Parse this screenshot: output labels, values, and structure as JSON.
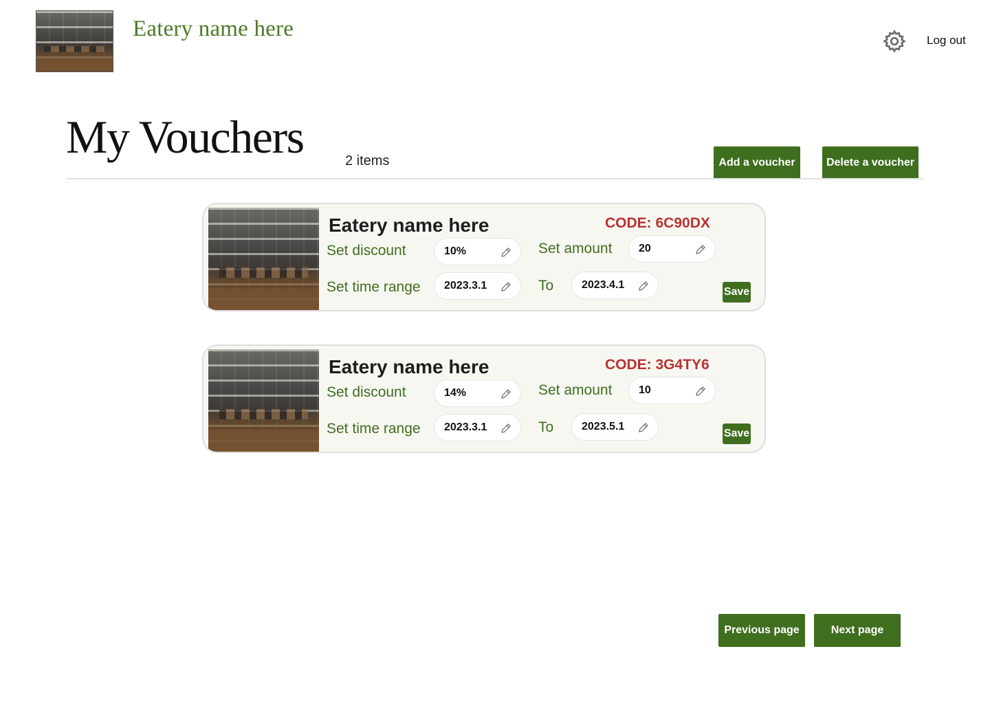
{
  "header": {
    "brand_name": "Eatery name here",
    "logout_label": "Log out",
    "settings_icon": "gear-icon",
    "logo_image": "restaurant-interior-photo"
  },
  "main": {
    "title": "My Vouchers",
    "item_count": "2 items",
    "add_label": "Add a voucher",
    "delete_label": "Delete a voucher"
  },
  "vouchers": [
    {
      "name": "Eatery name here",
      "code": "CODE: 6C90DX",
      "discount_label": "Set discount",
      "discount": "10%",
      "amount_label": "Set amount",
      "amount": "20",
      "time_label": "Set time range",
      "from": "2023.3.1",
      "to_label": "To",
      "to": "2023.4.1",
      "save_label": "Save"
    },
    {
      "name": "Eatery name here",
      "code": "CODE: 3G4TY6",
      "discount_label": "Set discount",
      "discount": "14%",
      "amount_label": "Set amount",
      "amount": "10",
      "time_label": "Set time range",
      "from": "2023.3.1",
      "to_label": "To",
      "to": "2023.5.1",
      "save_label": "Save"
    }
  ],
  "pagination": {
    "prev_label": "Previous page",
    "next_label": "Next page"
  },
  "colors": {
    "accent": "#3f6e1f",
    "brand_text": "#4a7a25",
    "code_text": "#b83232",
    "card_bg": "#f7f7f2"
  }
}
